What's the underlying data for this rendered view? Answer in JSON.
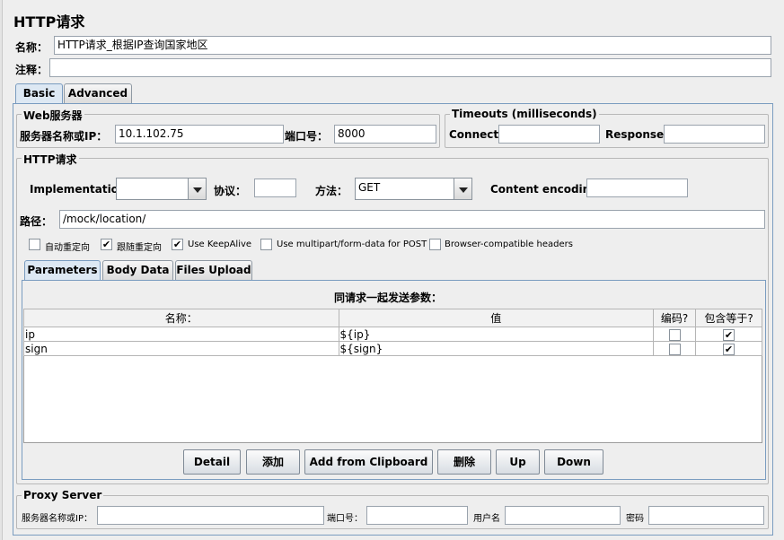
{
  "title": "HTTP请求",
  "name_label": "名称：",
  "name_value": "HTTP请求_根据IP查询国家地区",
  "comment_label": "注释：",
  "comment_value": "",
  "tabs": [
    "Basic",
    "Advanced"
  ],
  "active_tab": "Basic",
  "web_server": {
    "legend": "Web服务器",
    "server_label": "服务器名称或IP：",
    "server_value": "10.1.102.75",
    "port_label": "端口号：",
    "port_value": "8000"
  },
  "timeouts": {
    "legend": "Timeouts (milliseconds)",
    "connect_label": "Connect:",
    "connect_value": "",
    "response_label": "Response:",
    "response_value": ""
  },
  "http_request": {
    "legend": "HTTP请求",
    "implementation_label": "Implementation:",
    "implementation_value": "",
    "protocol_label": "协议：",
    "protocol_value": "",
    "method_label": "方法：",
    "method_value": "GET",
    "encoding_label": "Content encoding:",
    "encoding_value": "",
    "path_label": "路径：",
    "path_value": "/mock/location/"
  },
  "options": [
    {
      "label": "自动重定向",
      "checked": false
    },
    {
      "label": "跟随重定向",
      "checked": true
    },
    {
      "label": "Use KeepAlive",
      "checked": true
    },
    {
      "label": "Use multipart/form-data for POST",
      "checked": false
    },
    {
      "label": "Browser-compatible headers",
      "checked": false
    }
  ],
  "sub_tabs": [
    "Parameters",
    "Body Data",
    "Files Upload"
  ],
  "active_sub_tab": "Parameters",
  "params": {
    "caption": "同请求一起发送参数：",
    "columns": [
      "名称：",
      "值",
      "编码?",
      "包含等于?"
    ],
    "rows": [
      {
        "name": "ip",
        "value": "${ip}",
        "encode": false,
        "include_equals": true
      },
      {
        "name": "sign",
        "value": "${sign}",
        "encode": false,
        "include_equals": true
      }
    ]
  },
  "buttons": [
    "Detail",
    "添加",
    "Add from Clipboard",
    "删除",
    "Up",
    "Down"
  ],
  "proxy": {
    "legend": "Proxy Server",
    "server_label": "服务器名称或IP：",
    "port_label": "端口号：",
    "user_label": "用户名",
    "password_label": "密码",
    "server_value": "",
    "port_value": "",
    "user_value": "",
    "password_value": ""
  },
  "check_mark": "✔"
}
